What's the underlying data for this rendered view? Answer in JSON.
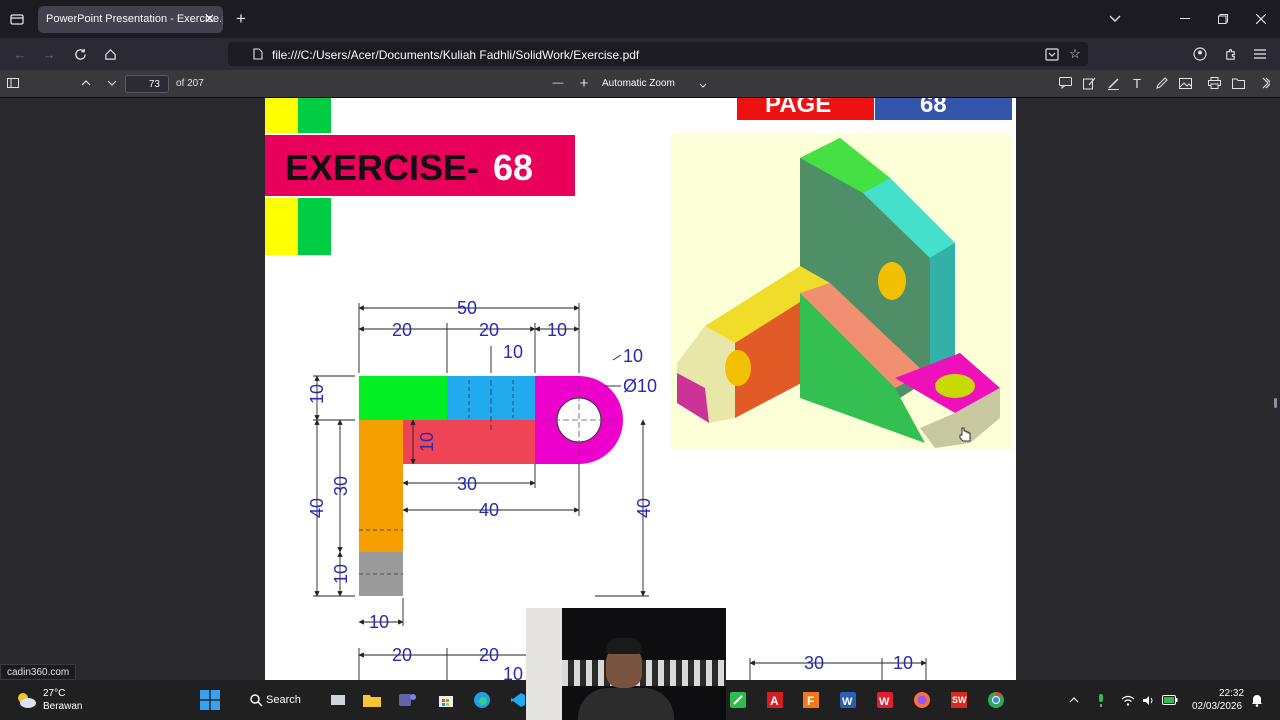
{
  "browser": {
    "tab_title": "PowerPoint Presentation - Exercise.pdf",
    "tab_close": "✕",
    "new_tab": "+",
    "url": "file:///C:/Users/Acer/Documents/Kuliah Fadhli/SolidWork/Exercise.pdf",
    "status_url": "cadin360.com"
  },
  "pdf_toolbar": {
    "current_page": "73",
    "page_count_label": "of 207",
    "zoom_label": "Automatic Zoom",
    "zoom_out": "—",
    "zoom_in": "+"
  },
  "document": {
    "page_label": "PAGE",
    "page_number": "68",
    "exercise_word": "EXERCISE-",
    "exercise_number": "68",
    "dims": {
      "d50": "50",
      "d20a": "20",
      "d20b": "20",
      "d10a": "10",
      "d10b": "10",
      "r10": "10",
      "dia10": "Ø10",
      "v10a": "10",
      "v10b": "10",
      "v30": "30",
      "v40a": "40",
      "v10c": "10",
      "h30": "30",
      "h40": "40",
      "v40b": "40",
      "b10": "10",
      "b20a": "20",
      "b20b": "20",
      "b10b": "10",
      "r30": "30"
    }
  },
  "taskbar": {
    "temperature": "27°C",
    "weather": "Berawan",
    "search_label": "Search",
    "time": "22:32",
    "date": "02/03/2026"
  },
  "colors": {
    "accent_pink": "#e8005a",
    "dim_blue": "#2a2ab0",
    "green": "#00cc44",
    "yellow": "#ffff00"
  }
}
